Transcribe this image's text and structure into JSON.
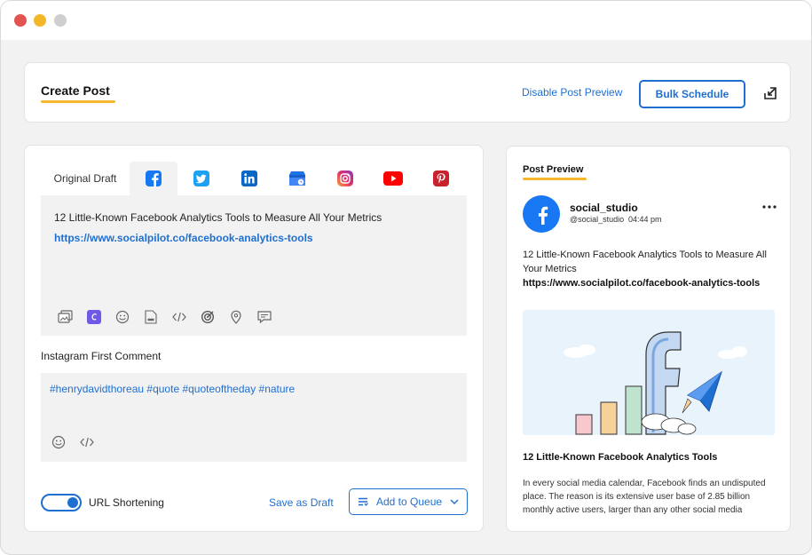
{
  "header": {
    "title": "Create Post",
    "disable_preview_label": "Disable Post Preview",
    "bulk_schedule_label": "Bulk Schedule",
    "collapse_icon": "collapse-arrow-icon"
  },
  "editor": {
    "tabs": [
      {
        "label": "Original Draft",
        "type": "text"
      },
      {
        "icon": "facebook-icon",
        "color": "#1877f2",
        "active": true
      },
      {
        "icon": "twitter-icon",
        "color": "#1da1f2"
      },
      {
        "icon": "linkedin-icon",
        "color": "#0a66c2"
      },
      {
        "icon": "google-business-icon",
        "color": "#4285f4"
      },
      {
        "icon": "instagram-icon",
        "color": "#e1306c"
      },
      {
        "icon": "youtube-icon",
        "color": "#ff0000"
      },
      {
        "icon": "pinterest-icon",
        "color": "#c8232c"
      }
    ],
    "post_text": "12 Little-Known Facebook Analytics Tools to Measure All Your Metrics",
    "post_link": "https://www.socialpilot.co/facebook-analytics-tools",
    "instagram_label": "Instagram First Comment",
    "comment_text": "#henrydavidthoreau #quote #quoteoftheday #nature",
    "url_shortening_label": "URL Shortening",
    "url_shortening_on": true,
    "save_draft_label": "Save as Draft",
    "add_queue_label": "Add to Queue"
  },
  "preview": {
    "title": "Post Preview",
    "account_name": "social_studio",
    "account_handle": "@social_studio",
    "time": "04:44 pm",
    "text": "12 Little-Known Facebook Analytics Tools to Measure All Your Metrics",
    "link": "https://www.socialpilot.co/facebook-analytics-tools",
    "article_title": "12 Little-Known Facebook Analytics Tools",
    "article_desc": "In every social media calendar, Facebook finds an undisputed place. The reason is its extensive user base of 2.85 billion monthly active users, larger than any other social media"
  },
  "colors": {
    "accent": "#1f6fd1",
    "highlight": "#f5b72a",
    "facebook": "#1877f2"
  }
}
